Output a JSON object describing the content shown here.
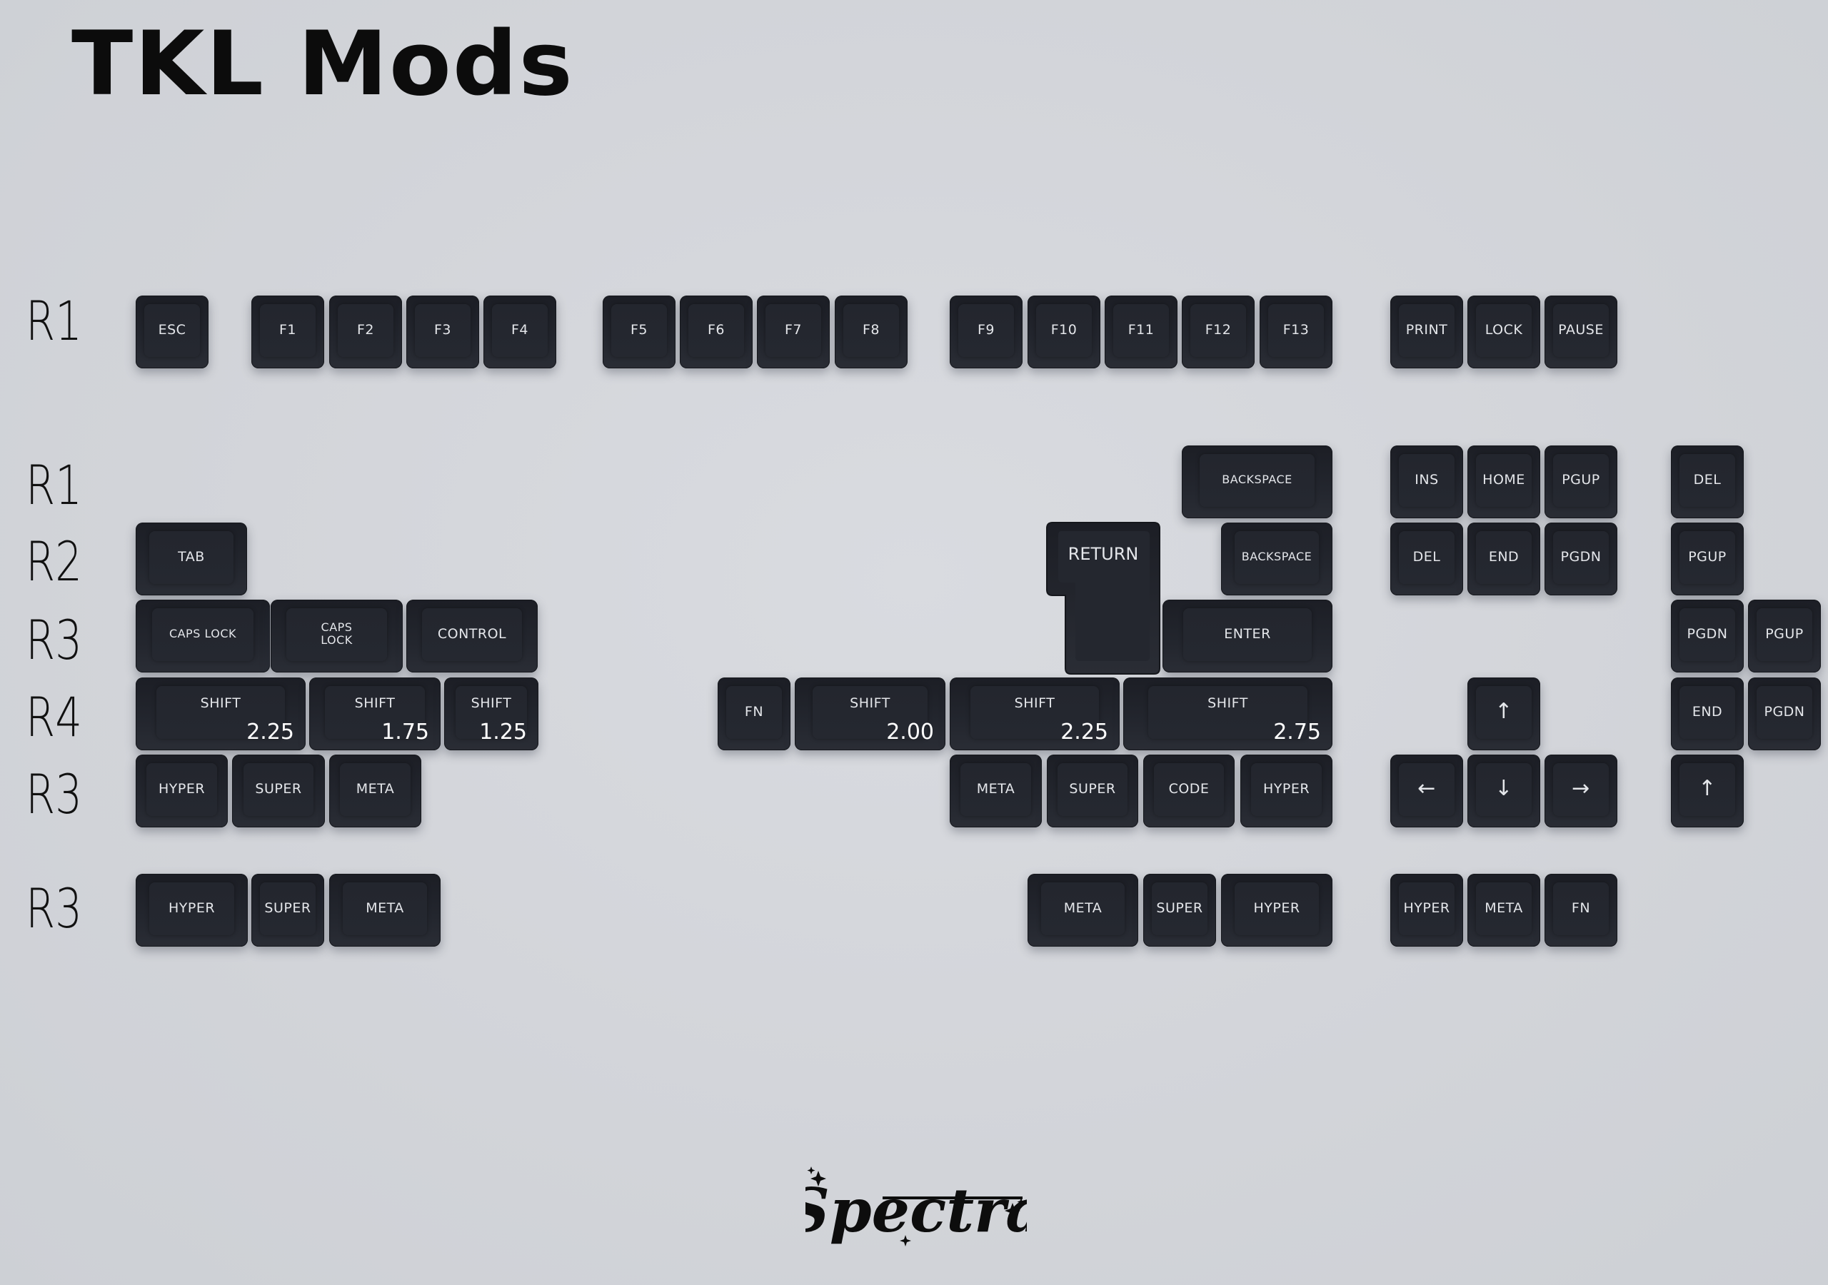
{
  "title": "TKL Mods",
  "row_labels": [
    "R1",
    "R1",
    "R2",
    "R3",
    "R4",
    "R3",
    "R3"
  ],
  "keys": [
    {
      "label": "ESC"
    },
    {
      "label": "F1"
    },
    {
      "label": "F2"
    },
    {
      "label": "F3"
    },
    {
      "label": "F4"
    },
    {
      "label": "F5"
    },
    {
      "label": "F6"
    },
    {
      "label": "F7"
    },
    {
      "label": "F8"
    },
    {
      "label": "F9"
    },
    {
      "label": "F10"
    },
    {
      "label": "F11"
    },
    {
      "label": "F12"
    },
    {
      "label": "F13"
    },
    {
      "label": "PRINT"
    },
    {
      "label": "LOCK"
    },
    {
      "label": "PAUSE"
    },
    {
      "label": "BACKSPACE"
    },
    {
      "label": "INS"
    },
    {
      "label": "HOME"
    },
    {
      "label": "PGUP"
    },
    {
      "label": "DEL"
    },
    {
      "label": "TAB"
    },
    {
      "label": "BACKSPACE"
    },
    {
      "label": "DEL"
    },
    {
      "label": "END"
    },
    {
      "label": "PGDN"
    },
    {
      "label": "PGUP"
    },
    {
      "label": "CAPS  LOCK"
    },
    {
      "label": "CAPS\nLOCK"
    },
    {
      "label": "CONTROL"
    },
    {
      "label": "ENTER"
    },
    {
      "label": "PGDN"
    },
    {
      "label": "PGUP"
    },
    {
      "label": "SHIFT",
      "size": "2.25"
    },
    {
      "label": "SHIFT",
      "size": "1.75"
    },
    {
      "label": "SHIFT",
      "size": "1.25"
    },
    {
      "label": "FN"
    },
    {
      "label": "SHIFT",
      "size": "2.00"
    },
    {
      "label": "SHIFT",
      "size": "2.25"
    },
    {
      "label": "SHIFT",
      "size": "2.75"
    },
    {
      "label": "↑",
      "icon": "arrow-up-icon"
    },
    {
      "label": "END"
    },
    {
      "label": "PGDN"
    },
    {
      "label": "HYPER"
    },
    {
      "label": "SUPER"
    },
    {
      "label": "META"
    },
    {
      "label": "META"
    },
    {
      "label": "SUPER"
    },
    {
      "label": "CODE"
    },
    {
      "label": "HYPER"
    },
    {
      "label": "←",
      "icon": "arrow-left-icon"
    },
    {
      "label": "↓",
      "icon": "arrow-down-icon"
    },
    {
      "label": "→",
      "icon": "arrow-right-icon"
    },
    {
      "label": "↑",
      "icon": "arrow-up-icon"
    },
    {
      "label": "HYPER"
    },
    {
      "label": "SUPER"
    },
    {
      "label": "META"
    },
    {
      "label": "META"
    },
    {
      "label": "SUPER"
    },
    {
      "label": "HYPER"
    },
    {
      "label": "HYPER"
    },
    {
      "label": "META"
    },
    {
      "label": "FN"
    }
  ],
  "return_key": {
    "label": "RETURN"
  },
  "brand": {
    "name": "Spectra"
  }
}
